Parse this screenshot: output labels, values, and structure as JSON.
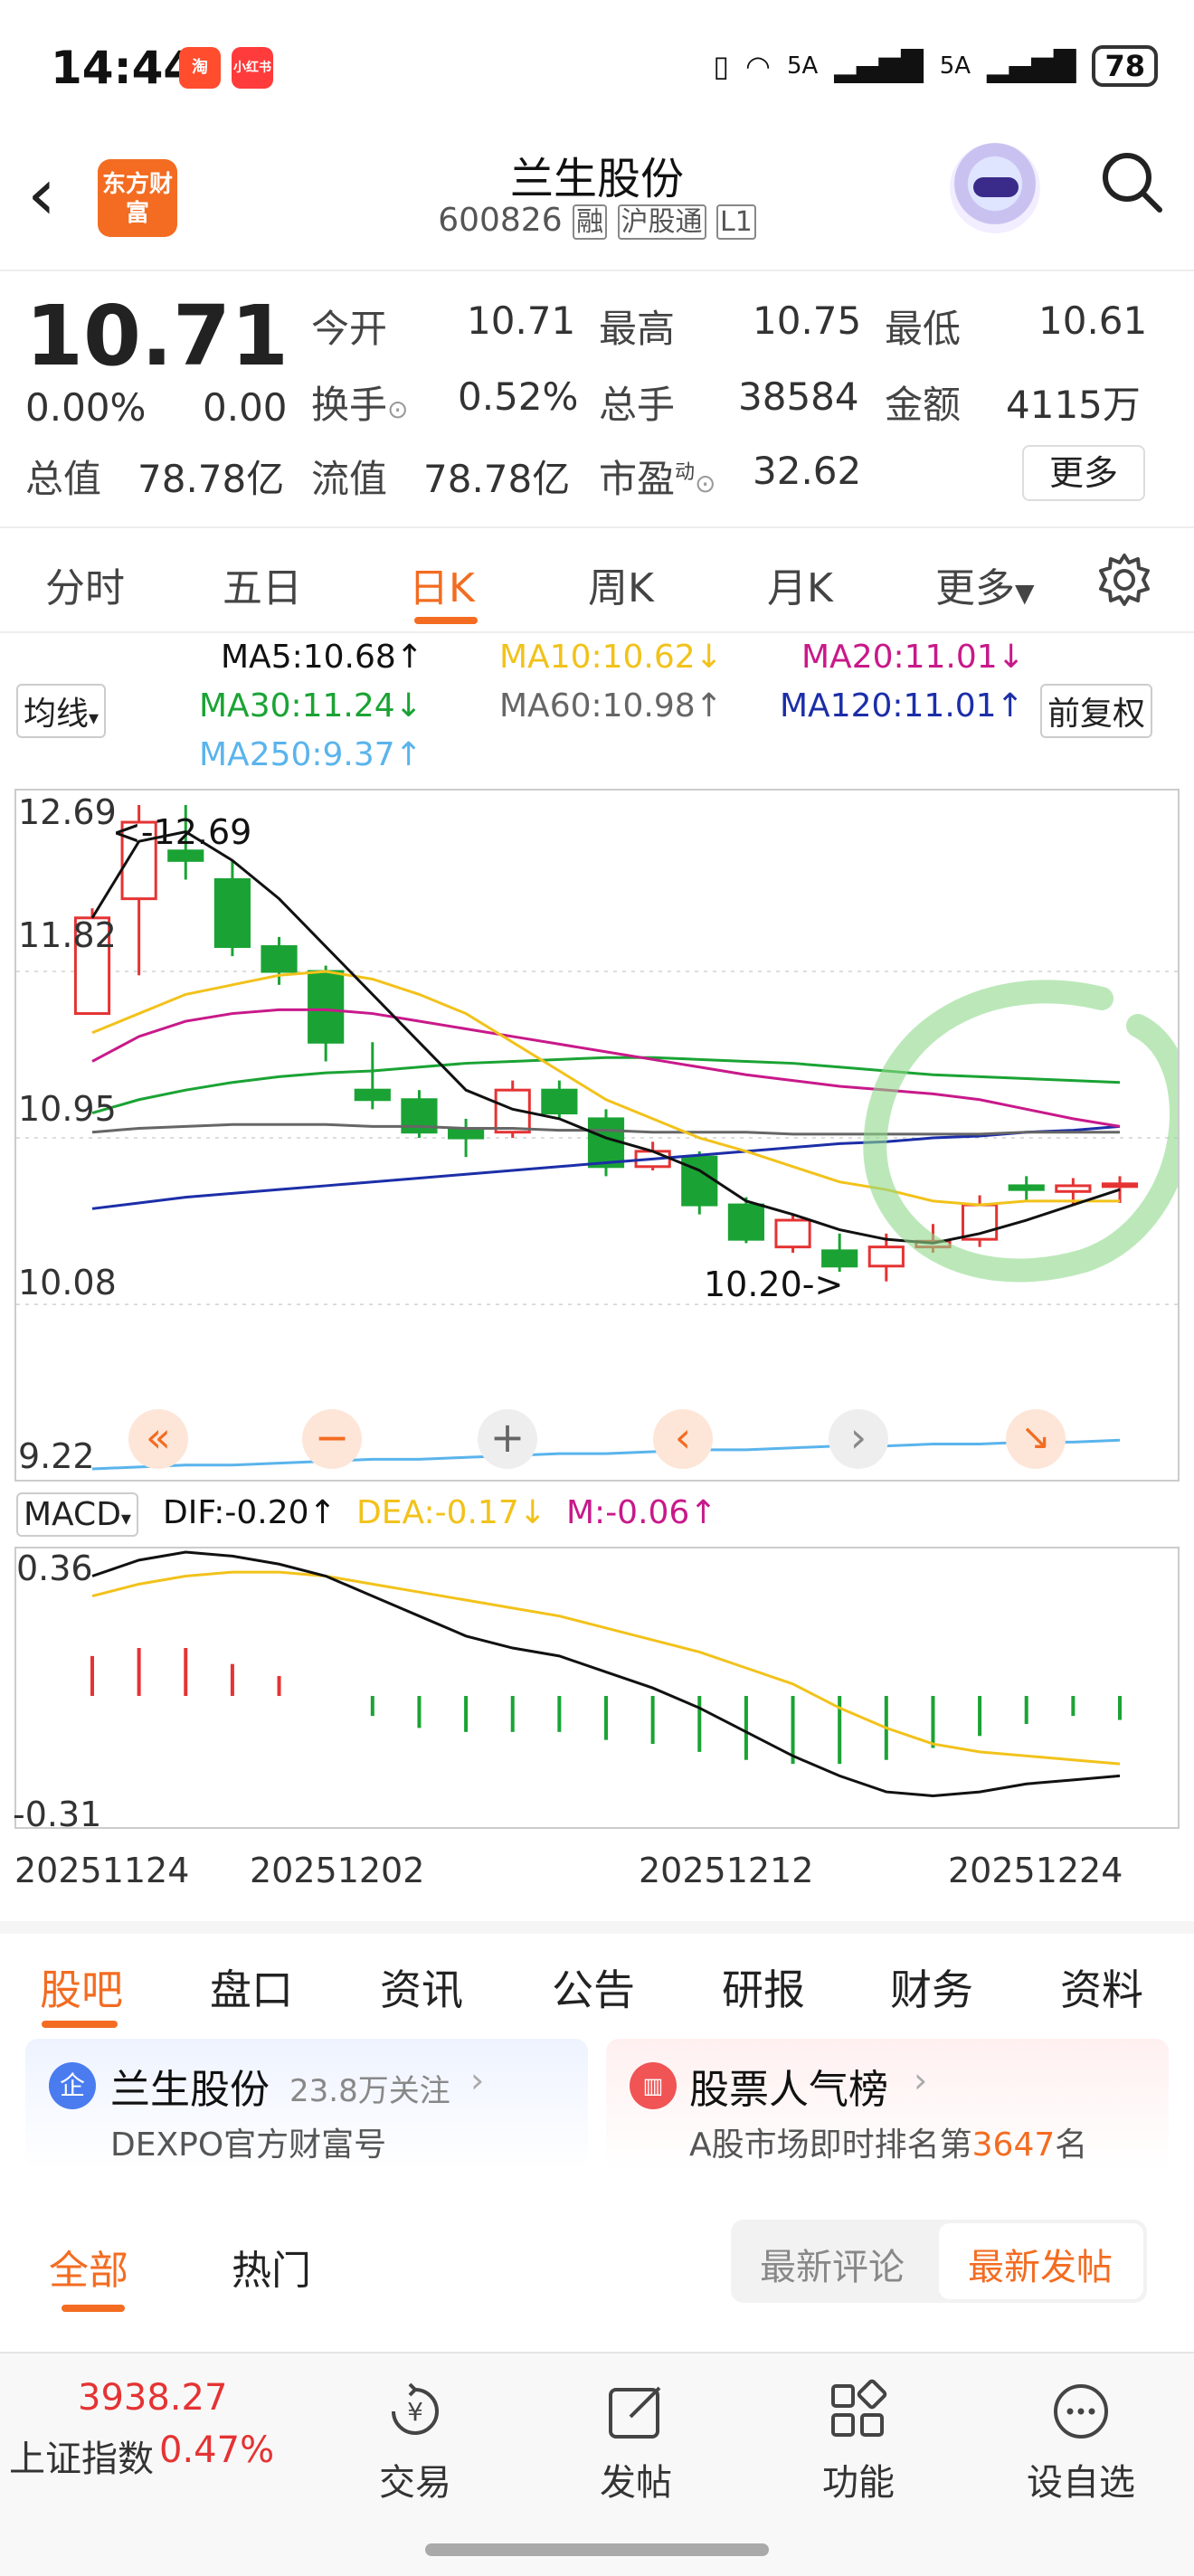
{
  "status_bar": {
    "time": "14:44",
    "app_icons": [
      "淘",
      "小红书"
    ],
    "network_1": "5A",
    "network_2": "5A",
    "battery": "78"
  },
  "header": {
    "logo_text": "东方财富",
    "title": "兰生股份",
    "code": "600826",
    "tags": [
      "融",
      "沪股通",
      "L1"
    ]
  },
  "quote": {
    "price": "10.71",
    "change_pct": "0.00%",
    "change": "0.00",
    "open_label": "今开",
    "open": "10.71",
    "high_label": "最高",
    "high": "10.75",
    "low_label": "最低",
    "low": "10.61",
    "turnover_label": "换手",
    "turnover": "0.52%",
    "volume_label": "总手",
    "volume": "38584",
    "amount_label": "金额",
    "amount": "4115万",
    "mktcap_label": "总值",
    "mktcap": "78.78亿",
    "float_label": "流值",
    "float": "78.78亿",
    "pe_label": "市盈",
    "pe_sup": "动",
    "pe": "32.62",
    "more_label": "更多"
  },
  "period_tabs": [
    "分时",
    "五日",
    "日K",
    "周K",
    "月K",
    "更多"
  ],
  "active_period": "日K",
  "ma_legend": {
    "indicator_select": "均线",
    "ma5": "MA5:10.68↑",
    "ma10": "MA10:10.62↓",
    "ma20": "MA20:11.01↓",
    "ma30": "MA30:11.24↓",
    "ma60": "MA60:10.98↑",
    "ma120": "MA120:11.01↑",
    "ma250": "MA250:9.37↑",
    "adjust": "前复权"
  },
  "colors": {
    "accent": "#f36c21",
    "up": "#e53333",
    "down": "#1aa334",
    "ma5": "#111111",
    "ma10": "#f2c21b",
    "ma20": "#c8198a",
    "ma30": "#1aa334",
    "ma60": "#666666",
    "ma120": "#1c2ea8",
    "ma250": "#5ab4ec"
  },
  "kchart_axis": {
    "y_ticks": [
      "12.69",
      "11.82",
      "10.95",
      "10.08",
      "9.22"
    ],
    "high_marker": "<-12.69",
    "low_marker": "10.20->"
  },
  "macd_legend": {
    "indicator_select": "MACD",
    "dif": "DIF:-0.20↑",
    "dea": "DEA:-0.17↓",
    "m": "M:-0.06↑",
    "y_top": "0.36",
    "y_bottom": "-0.31"
  },
  "x_dates": [
    "20251124",
    "20251202",
    "20251212",
    "20251224"
  ],
  "chart_data": {
    "type": "candlestick",
    "y_range": [
      9.22,
      12.69
    ],
    "candles": [
      {
        "o": 11.6,
        "h": 12.15,
        "l": 11.85,
        "c": 12.1
      },
      {
        "o": 12.2,
        "h": 12.69,
        "l": 11.8,
        "c": 12.6
      },
      {
        "o": 12.45,
        "h": 12.69,
        "l": 12.3,
        "c": 12.4
      },
      {
        "o": 12.3,
        "h": 12.4,
        "l": 11.9,
        "c": 11.95
      },
      {
        "o": 11.95,
        "h": 12.0,
        "l": 11.75,
        "c": 11.82
      },
      {
        "o": 11.82,
        "h": 11.85,
        "l": 11.35,
        "c": 11.45
      },
      {
        "o": 11.2,
        "h": 11.45,
        "l": 11.1,
        "c": 11.15
      },
      {
        "o": 11.15,
        "h": 11.2,
        "l": 10.95,
        "c": 10.98
      },
      {
        "o": 11.0,
        "h": 11.05,
        "l": 10.85,
        "c": 10.95
      },
      {
        "o": 10.98,
        "h": 11.25,
        "l": 10.95,
        "c": 11.2
      },
      {
        "o": 11.2,
        "h": 11.25,
        "l": 11.05,
        "c": 11.08
      },
      {
        "o": 11.05,
        "h": 11.1,
        "l": 10.75,
        "c": 10.8
      },
      {
        "o": 10.8,
        "h": 10.93,
        "l": 10.78,
        "c": 10.88
      },
      {
        "o": 10.85,
        "h": 10.88,
        "l": 10.55,
        "c": 10.6
      },
      {
        "o": 10.6,
        "h": 10.64,
        "l": 10.4,
        "c": 10.42
      },
      {
        "o": 10.38,
        "h": 10.55,
        "l": 10.35,
        "c": 10.52
      },
      {
        "o": 10.36,
        "h": 10.45,
        "l": 10.25,
        "c": 10.28
      },
      {
        "o": 10.28,
        "h": 10.45,
        "l": 10.2,
        "c": 10.38
      },
      {
        "o": 10.38,
        "h": 10.5,
        "l": 10.35,
        "c": 10.41
      },
      {
        "o": 10.42,
        "h": 10.65,
        "l": 10.38,
        "c": 10.6
      },
      {
        "o": 10.7,
        "h": 10.75,
        "l": 10.62,
        "c": 10.68
      },
      {
        "o": 10.67,
        "h": 10.74,
        "l": 10.6,
        "c": 10.7
      },
      {
        "o": 10.71,
        "h": 10.75,
        "l": 10.61,
        "c": 10.71
      }
    ],
    "ma_lines": {
      "ma5": [
        12.1,
        12.5,
        12.55,
        12.4,
        12.2,
        11.95,
        11.7,
        11.45,
        11.2,
        11.1,
        11.05,
        10.95,
        10.88,
        10.78,
        10.62,
        10.55,
        10.47,
        10.42,
        10.4,
        10.45,
        10.52,
        10.6,
        10.68
      ],
      "ma10": [
        11.5,
        11.6,
        11.7,
        11.75,
        11.8,
        11.82,
        11.78,
        11.7,
        11.6,
        11.45,
        11.3,
        11.15,
        11.05,
        10.95,
        10.88,
        10.8,
        10.72,
        10.68,
        10.62,
        10.6,
        10.62,
        10.62,
        10.62
      ],
      "ma20": [
        11.35,
        11.48,
        11.56,
        11.6,
        11.62,
        11.62,
        11.6,
        11.56,
        11.52,
        11.48,
        11.44,
        11.4,
        11.36,
        11.32,
        11.28,
        11.25,
        11.22,
        11.2,
        11.18,
        11.15,
        11.1,
        11.05,
        11.01
      ],
      "ma30": [
        11.08,
        11.15,
        11.2,
        11.24,
        11.27,
        11.29,
        11.3,
        11.32,
        11.34,
        11.35,
        11.36,
        11.37,
        11.37,
        11.36,
        11.35,
        11.34,
        11.32,
        11.3,
        11.28,
        11.27,
        11.26,
        11.25,
        11.24
      ],
      "ma60": [
        10.98,
        11.0,
        11.01,
        11.02,
        11.02,
        11.02,
        11.01,
        11.01,
        11.0,
        11.0,
        10.99,
        10.99,
        10.98,
        10.98,
        10.98,
        10.97,
        10.97,
        10.97,
        10.97,
        10.97,
        10.98,
        10.98,
        10.98
      ],
      "ma120": [
        10.58,
        10.61,
        10.64,
        10.66,
        10.68,
        10.7,
        10.72,
        10.74,
        10.76,
        10.78,
        10.8,
        10.82,
        10.84,
        10.86,
        10.88,
        10.9,
        10.92,
        10.93,
        10.95,
        10.96,
        10.98,
        10.99,
        11.01
      ],
      "ma250": [
        9.22,
        9.23,
        9.24,
        9.24,
        9.25,
        9.26,
        9.27,
        9.27,
        9.28,
        9.29,
        9.3,
        9.3,
        9.31,
        9.32,
        9.32,
        9.33,
        9.34,
        9.34,
        9.35,
        9.35,
        9.36,
        9.36,
        9.37
      ]
    },
    "macd": {
      "y_range": [
        -0.31,
        0.36
      ],
      "dif": [
        0.3,
        0.34,
        0.36,
        0.35,
        0.33,
        0.3,
        0.25,
        0.2,
        0.15,
        0.12,
        0.1,
        0.06,
        0.02,
        -0.03,
        -0.09,
        -0.15,
        -0.2,
        -0.24,
        -0.25,
        -0.24,
        -0.22,
        -0.21,
        -0.2
      ],
      "dea": [
        0.25,
        0.28,
        0.3,
        0.31,
        0.31,
        0.3,
        0.28,
        0.26,
        0.24,
        0.22,
        0.2,
        0.17,
        0.14,
        0.11,
        0.07,
        0.03,
        -0.03,
        -0.08,
        -0.12,
        -0.14,
        -0.15,
        -0.16,
        -0.17
      ],
      "m": [
        0.1,
        0.12,
        0.12,
        0.08,
        0.05,
        0.0,
        -0.05,
        -0.08,
        -0.09,
        -0.09,
        -0.09,
        -0.11,
        -0.12,
        -0.14,
        -0.16,
        -0.17,
        -0.17,
        -0.16,
        -0.13,
        -0.1,
        -0.07,
        -0.05,
        -0.06
      ]
    }
  },
  "chart_toolbar": [
    "«",
    "−",
    "+",
    "‹",
    "›",
    "↘"
  ],
  "community_tabs": [
    "股吧",
    "盘口",
    "资讯",
    "公告",
    "研报",
    "财务",
    "资料"
  ],
  "active_community_tab": "股吧",
  "cards": {
    "left": {
      "badge": "企",
      "title": "兰生股份",
      "followers": "23.8万关注",
      "sub": "DEXPO官方财富号"
    },
    "right": {
      "title": "股票人气榜",
      "sub_prefix": "A股市场即时排名第",
      "rank": "3647",
      "sub_suffix": "名"
    }
  },
  "filters": {
    "all": "全部",
    "hot": "热门",
    "latest_comment": "最新评论",
    "latest_post": "最新发帖"
  },
  "bottom": {
    "index_value": "3938.27",
    "index_name": "上证指数",
    "index_change": "0.47%",
    "nav": [
      "交易",
      "发帖",
      "功能",
      "设自选"
    ]
  }
}
